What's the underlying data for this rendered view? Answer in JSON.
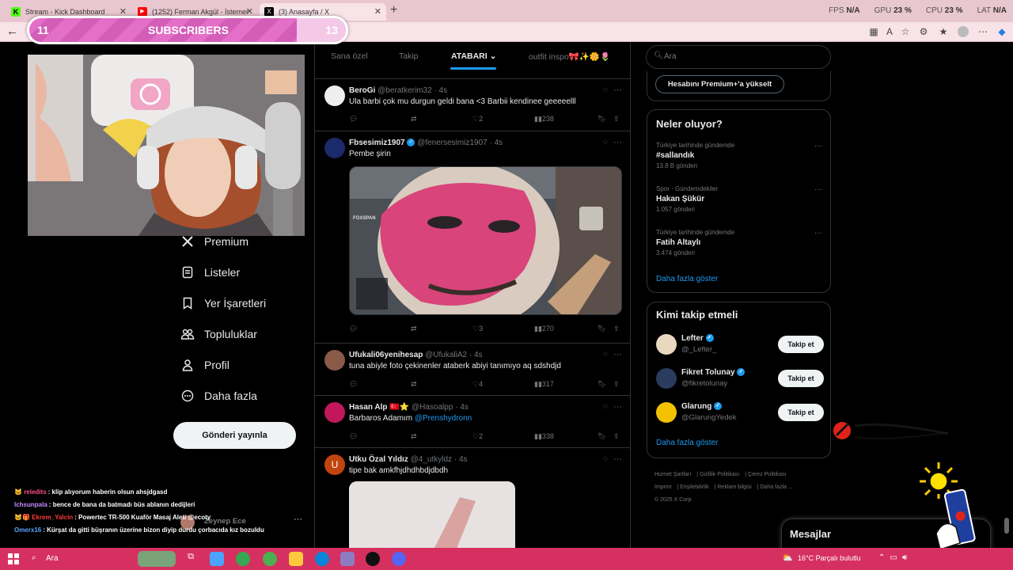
{
  "browser": {
    "tabs": [
      {
        "title": "Stream - Kick Dashboard",
        "favicon_color": "#53fc18",
        "favicon_glyph": "K"
      },
      {
        "title": "(1252) Ferman Akgül - İstemem Sö...",
        "favicon_color": "#ff0000",
        "favicon_glyph": "▶"
      },
      {
        "title": "(3) Anasayfa / X",
        "favicon_color": "#000000",
        "favicon_glyph": "X"
      }
    ],
    "new_tab_icon": "plus-icon",
    "stats": [
      {
        "label": "FPS",
        "value": "N/A"
      },
      {
        "label": "GPU",
        "value": "23 %"
      },
      {
        "label": "CPU",
        "value": "23 %"
      },
      {
        "label": "LAT",
        "value": "N/A"
      }
    ]
  },
  "overlay": {
    "subscribers_label": "SUBSCRIBERS",
    "current": "11",
    "goal": "13",
    "progress_fraction": 0.846
  },
  "nav": {
    "items": [
      {
        "label": "Premium",
        "icon": "x-logo-icon"
      },
      {
        "label": "Listeler",
        "icon": "list-icon"
      },
      {
        "label": "Yer İşaretleri",
        "icon": "bookmark-icon"
      },
      {
        "label": "Topluluklar",
        "icon": "communities-icon"
      },
      {
        "label": "Profil",
        "icon": "person-icon"
      },
      {
        "label": "Daha fazla",
        "icon": "more-circle-icon"
      }
    ],
    "post_button": "Gönderi yayınla",
    "account_name": "Zeynep Ece"
  },
  "chat": [
    {
      "user": "reledits",
      "user_color": "#ff4b8b",
      "msg": "klip alıyorum haberin olsun ahsjdgasd"
    },
    {
      "user": "lchsunpala",
      "user_color": "#c88bff",
      "msg": "bence de bana da batmadı büs ablanın dedijleri"
    },
    {
      "user": "Ekrem_Yalcin",
      "user_color": "#ff3b3b",
      "msg": "Powertec TR-500 Kuaför Masaj Aleti @ecoty"
    },
    {
      "user": "Omerx16",
      "user_color": "#58a6ff",
      "msg": "Kürşat da gitti büşranın üzerine bizon diyip durdu çorbacıda kız bozuldu"
    }
  ],
  "timeline": {
    "tabs": [
      "Sana özel",
      "Takip",
      "ATABARI",
      "outfit inspo🎀✨🌼🌷"
    ],
    "active_tab": "ATABARI",
    "tweets": [
      {
        "name": "BeroGi",
        "handle": "@beratkerim32",
        "time": "4s",
        "text": "Ula barbi çok mu durgun geldi bana <3 Barbii kendinee geeeeelll",
        "replies": "",
        "retweets": "",
        "likes": "2",
        "views": "238",
        "verified": false,
        "avatar_color": "#eeeeee"
      },
      {
        "name": "Fbsesimiz1907",
        "handle": "@fenersesimiz1907",
        "time": "4s",
        "text": "Pembe şirin",
        "replies": "",
        "retweets": "",
        "likes": "3",
        "views": "270",
        "verified": true,
        "avatar_color": "#1b2a6b",
        "image_overlay_text": "FOXSPAN"
      },
      {
        "name": "Ufukali06yenihesap",
        "handle": "@UfukaliA2",
        "time": "4s",
        "text": "tuna abiyle foto çekinenler ataberk abiyi tanımıyo aq sdshdjd",
        "replies": "",
        "retweets": "",
        "likes": "4",
        "views": "317",
        "verified": false,
        "avatar_color": "#8a5a48"
      },
      {
        "name": "Hasan Alp",
        "flag": "🇹🇷⭐",
        "handle": "@Hasoalpp",
        "time": "4s",
        "text": "Barbaros Adamım",
        "mention": "@Prenshydronn",
        "replies": "",
        "retweets": "",
        "likes": "2",
        "views": "338",
        "verified": false,
        "avatar_color": "#c2185b"
      },
      {
        "name": "Utku Özal Yıldız",
        "handle": "@4_utkyldz",
        "time": "4s",
        "text": "tipe bak amkfhjdhdhbdjdbdh",
        "verified": false,
        "avatar_color": "#c1440e",
        "avatar_letter": "U"
      }
    ]
  },
  "right": {
    "search_placeholder": "Ara",
    "premium_button": "Hesabını Premium+'a yükselt",
    "trends_title": "Neler oluyor?",
    "trends": [
      {
        "category": "Türkiye tarihinde gündemde",
        "title": "#sallandık",
        "count": "13,8 B gönderi"
      },
      {
        "category": "Spor · Gündemdekiler",
        "title": "Hakan Şükür",
        "count": "1.057 gönderi"
      },
      {
        "category": "Türkiye tarihinde gündemde",
        "title": "Fatih Altaylı",
        "count": "3.474 gönderi"
      }
    ],
    "show_more": "Daha fazla göster",
    "wtf_title": "Kimi takip etmeli",
    "who_to_follow": [
      {
        "name": "Lefter",
        "handle": "@_Lefter_",
        "verified": true,
        "avatar_color": "#e8d8c0"
      },
      {
        "name": "Fikret Tolunay",
        "handle": "@fikretolunay",
        "verified": true,
        "avatar_color": "#2a3c5e"
      },
      {
        "name": "Glarung",
        "handle": "@GlarungYedek",
        "verified": true,
        "avatar_color": "#f2c200"
      }
    ],
    "follow_label": "Takip et",
    "footer": [
      "Hizmet Şartları",
      "Gizlilik Politikası",
      "Çerez Politikası",
      "Imprint",
      "Erişilebilirlik",
      "Reklam bilgisi",
      "Daha fazla ...",
      "© 2025 X Corp."
    ],
    "messages_label": "Mesajlar"
  },
  "taskbar": {
    "search": "Ara",
    "weather": "16°C  Parçalı bulutlu"
  }
}
